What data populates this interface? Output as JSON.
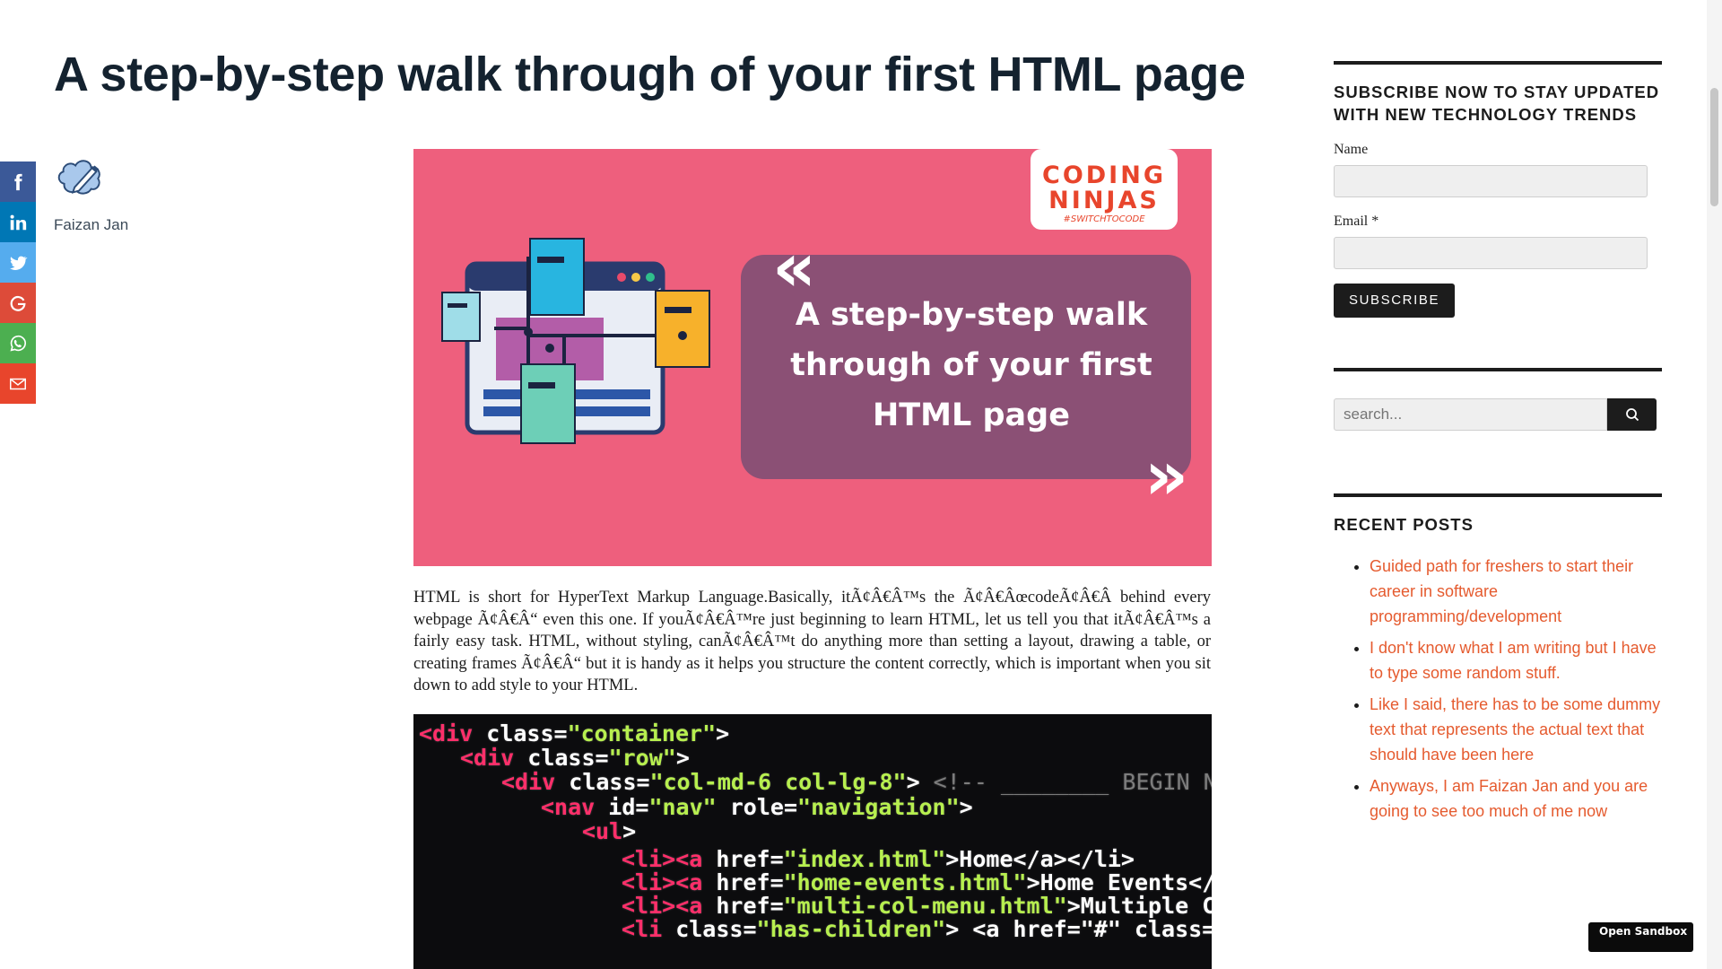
{
  "post": {
    "title": "A step-by-step walk through of your first HTML page",
    "author": "Faizan Jan",
    "paragraph": "HTML is short for HyperText Markup Language.Basically, itÃ¢Â€Â™s the Ã¢Â€ÂœcodeÃ¢Â€Â  behind every webpage Ã¢Â€Â“ even this one. If youÃ¢Â€Â™re just beginning to learn HTML, let us tell you that itÃ¢Â€Â™s a fairly easy task. HTML, without styling, canÃ¢Â€Â™t do anything more than setting a layout, drawing a table, or creating frames Ã¢Â€Â“ but it is handy as it helps you structure the content correctly, which is important when you sit down to add style to your HTML."
  },
  "hero": {
    "brand_line1": "CODING",
    "brand_line2": "NINJAS",
    "brand_tag": "#SWITCHTOCODE",
    "headline_lines": [
      "A step-by-step walk",
      "through of your first",
      "HTML page"
    ],
    "bg_color": "#ee5f7d",
    "panel_color": "#8b5075"
  },
  "code_image": {
    "lines": [
      {
        "indent": 0,
        "tag": "<div",
        "attr": " class=",
        "str": "\"container\"",
        "end": ">"
      },
      {
        "indent": 1,
        "tag": "<div",
        "attr": " class=",
        "str": "\"row\"",
        "end": ">"
      },
      {
        "indent": 2,
        "tag": "<div",
        "attr": " class=",
        "str": "\"col-md-6 col-lg-8\"",
        "end": ">",
        "comment": " <!-- ________ BEGIN NAVIGATION"
      },
      {
        "indent": 3,
        "tag": "<nav",
        "attr": " id=",
        "str": "\"nav\"",
        "attr2": " role=",
        "str2": "\"navigation\"",
        "end": ">"
      },
      {
        "indent": 4,
        "tag": "<ul",
        "end": ">"
      },
      {
        "indent": 5,
        "tag": "<li><a",
        "attr": " href=",
        "str": "\"index.html\"",
        "end": ">Home</a></li>"
      },
      {
        "indent": 5,
        "tag": "<li><a",
        "attr": " href=",
        "str": "\"home-events.html\"",
        "end": ">Home Events</a></li>"
      },
      {
        "indent": 5,
        "tag": "<li><a",
        "attr": " href=",
        "str": "\"multi-col-menu.html\"",
        "end": ">Multiple Column Menu"
      },
      {
        "indent": 5,
        "tag": "<li",
        "attr": " class=",
        "str": "\"has-children\"",
        "end": "> <a href=\"#\" class=\"current\">"
      }
    ]
  },
  "share_buttons": [
    {
      "name": "facebook",
      "color": "#3b5998"
    },
    {
      "name": "linkedin",
      "color": "#0077b5"
    },
    {
      "name": "twitter",
      "color": "#55acee"
    },
    {
      "name": "google",
      "color": "#dd4b39"
    },
    {
      "name": "whatsapp",
      "color": "#4caf50"
    },
    {
      "name": "email",
      "color": "#e8452c"
    }
  ],
  "sidebar": {
    "subscribe_title": "SUBSCRIBE NOW TO STAY UPDATED WITH NEW TECHNOLOGY TRENDS",
    "name_label": "Name",
    "email_label": "Email *",
    "subscribe_button": "SUBSCRIBE",
    "search_placeholder": "search...",
    "recent_title": "RECENT POSTS",
    "recent_posts": [
      "Guided path for freshers to start their career in software programming/development",
      "I don't know what I am writing but I have to type some random stuff.",
      "Like I said, there has to be some dummy text that represents the actual text that should have been here",
      "Anyways, I am Faizan Jan and you are going to see too much of me now"
    ],
    "link_color": "#e55b2f"
  },
  "sandbox_button": "Open Sandbox"
}
